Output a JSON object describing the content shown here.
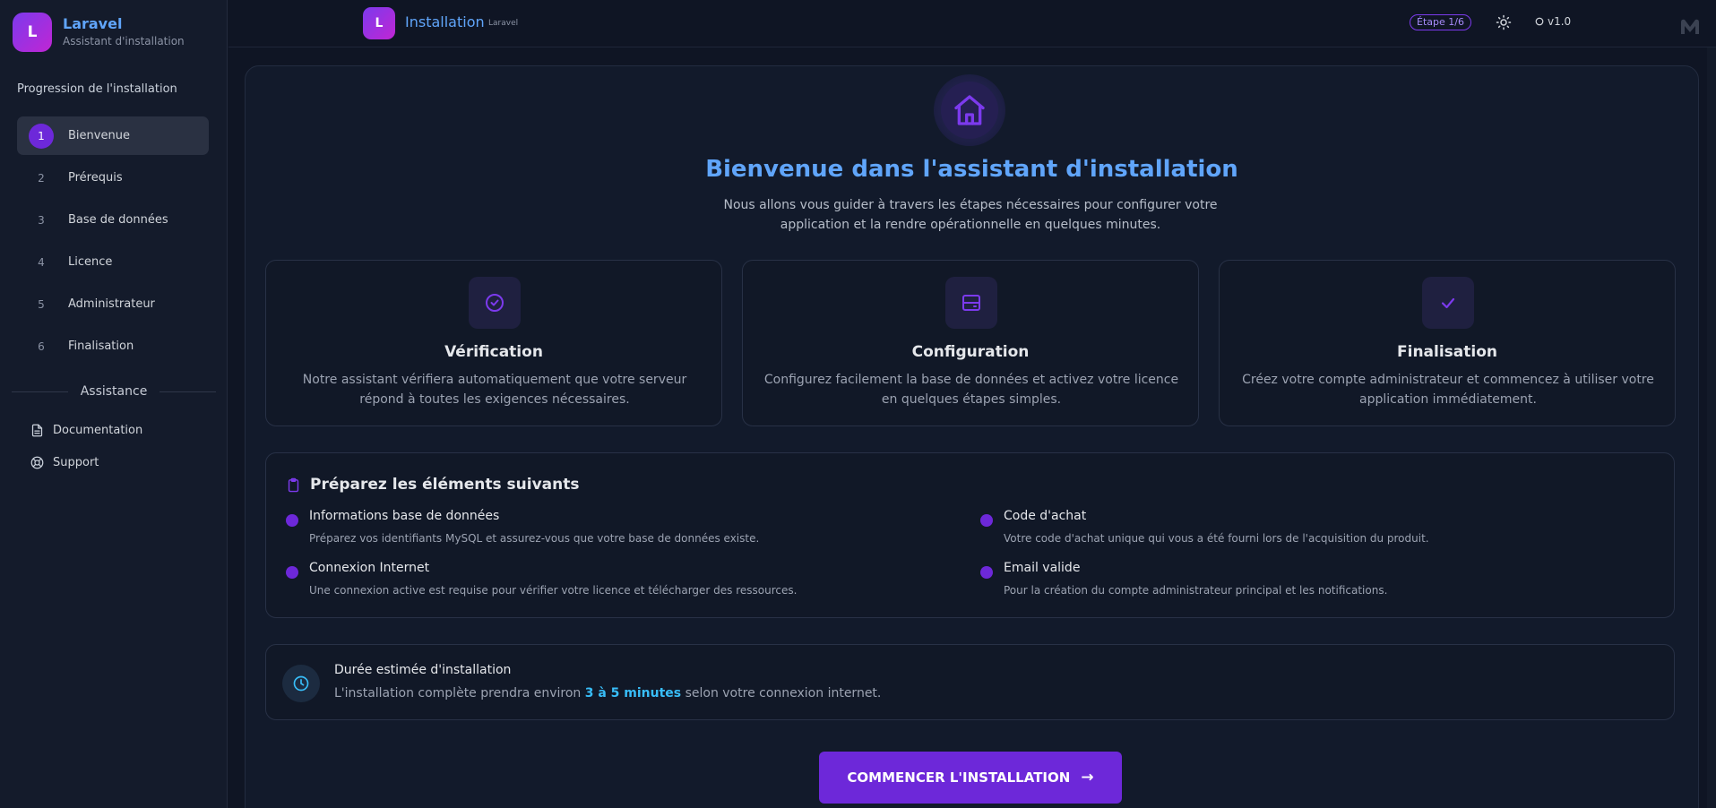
{
  "sidebar": {
    "logo_letter": "L",
    "app_name": "Laravel",
    "app_subtitle": "Assistant d'installation",
    "progress_title": "Progression de l'installation",
    "steps": [
      {
        "num": "1",
        "label": "Bienvenue",
        "active": true
      },
      {
        "num": "2",
        "label": "Prérequis",
        "active": false
      },
      {
        "num": "3",
        "label": "Base de données",
        "active": false
      },
      {
        "num": "4",
        "label": "Licence",
        "active": false
      },
      {
        "num": "5",
        "label": "Administrateur",
        "active": false
      },
      {
        "num": "6",
        "label": "Finalisation",
        "active": false
      }
    ],
    "assist_title": "Assistance",
    "links": [
      {
        "label": "Documentation",
        "icon": "document-icon"
      },
      {
        "label": "Support",
        "icon": "lifebuoy-icon"
      }
    ]
  },
  "header": {
    "logo_letter": "L",
    "title": "Installation",
    "subtitle": "Laravel",
    "step_badge": "Étape 1/6",
    "version": "v1.0"
  },
  "hero": {
    "icon": "home-icon",
    "title": "Bienvenue dans l'assistant d'installation",
    "text": "Nous allons vous guider à travers les étapes nécessaires pour configurer votre application et la rendre opérationnelle en quelques minutes."
  },
  "features": [
    {
      "icon": "check-circle-icon",
      "title": "Vérification",
      "text": "Notre assistant vérifiera automatiquement que votre serveur répond à toutes les exigences nécessaires."
    },
    {
      "icon": "server-icon",
      "title": "Configuration",
      "text": "Configurez facilement la base de données et activez votre licence en quelques étapes simples."
    },
    {
      "icon": "check-icon",
      "title": "Finalisation",
      "text": "Créez votre compte administrateur et commencez à utiliser votre application immédiatement."
    }
  ],
  "prepare": {
    "title": "Préparez les éléments suivants",
    "items": [
      {
        "title": "Informations base de données",
        "text": "Préparez vos identifiants MySQL et assurez-vous que votre base de données existe."
      },
      {
        "title": "Code d'achat",
        "text": "Votre code d'achat unique qui vous a été fourni lors de l'acquisition du produit."
      },
      {
        "title": "Connexion Internet",
        "text": "Une connexion active est requise pour vérifier votre licence et télécharger des ressources."
      },
      {
        "title": "Email valide",
        "text": "Pour la création du compte administrateur principal et les notifications."
      }
    ]
  },
  "duration": {
    "title": "Durée estimée d'installation",
    "text_before": "L'installation complète prendra environ ",
    "highlight": "3 à 5 minutes",
    "text_after": " selon votre connexion internet."
  },
  "start_button": {
    "label": "COMMENCER L'INSTALLATION",
    "arrow": "→"
  },
  "colors": {
    "background": "#0f1524",
    "sidebar": "#141b2b",
    "accent": "#6d28d9",
    "title_blue": "#60a5fa",
    "highlight_cyan": "#38bdf8"
  }
}
